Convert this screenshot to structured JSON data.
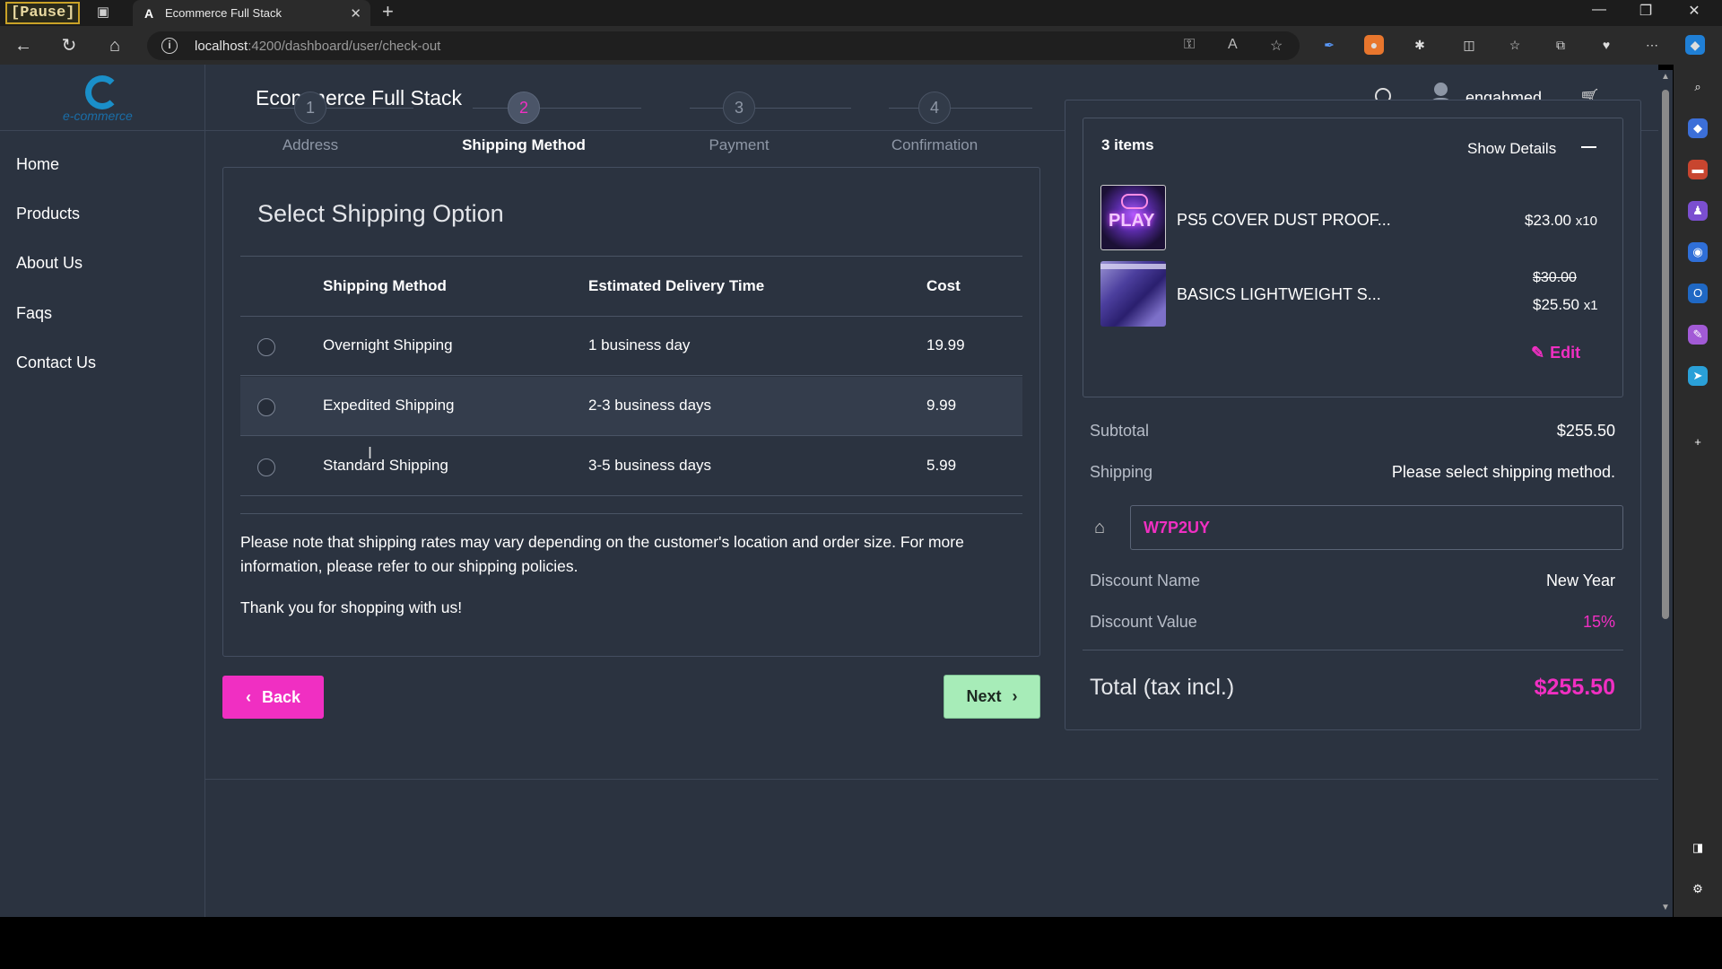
{
  "browser": {
    "pause_label": "[Pause]",
    "tab_title": "Ecommerce Full Stack",
    "url_host": "localhost",
    "url_path": ":4200/dashboard/user/check-out"
  },
  "app": {
    "logo_text": "e-commerce",
    "title": "Ecommerce Full Stack",
    "username": "engahmed"
  },
  "sidebar": {
    "items": [
      {
        "label": "Home"
      },
      {
        "label": "Products"
      },
      {
        "label": "About Us"
      },
      {
        "label": "Faqs"
      },
      {
        "label": "Contact Us"
      }
    ]
  },
  "stepper": {
    "steps": [
      {
        "num": "1",
        "label": "Address",
        "active": false
      },
      {
        "num": "2",
        "label": "Shipping Method",
        "active": true
      },
      {
        "num": "3",
        "label": "Payment",
        "active": false
      },
      {
        "num": "4",
        "label": "Confirmation",
        "active": false
      }
    ]
  },
  "shipping": {
    "title": "Select Shipping Option",
    "headers": {
      "method": "Shipping Method",
      "time": "Estimated Delivery Time",
      "cost": "Cost"
    },
    "options": [
      {
        "method": "Overnight Shipping",
        "time": "1 business day",
        "cost": "19.99"
      },
      {
        "method": "Expedited Shipping",
        "time": "2-3 business days",
        "cost": "9.99"
      },
      {
        "method": "Standard Shipping",
        "time": "3-5 business days",
        "cost": "5.99"
      }
    ],
    "note": "Please note that shipping rates may vary depending on the customer's location and order size. For more information, please refer to our shipping policies.",
    "thanks": "Thank you for shopping with us!"
  },
  "buttons": {
    "back": "Back",
    "next": "Next"
  },
  "summary": {
    "items_count": "3 items",
    "show_details": "Show Details",
    "items": [
      {
        "name": "PS5 COVER DUST PROOF...",
        "price": "$23.00",
        "qty": "x10",
        "old_price": ""
      },
      {
        "name": "BASICS LIGHTWEIGHT S...",
        "price": "$25.50",
        "qty": "x1",
        "old_price": "$30.00"
      }
    ],
    "edit": "Edit",
    "subtotal_label": "Subtotal",
    "subtotal_value": "$255.50",
    "shipping_label": "Shipping",
    "shipping_value": "Please select shipping method.",
    "coupon_code": "W7P2UY",
    "discount_name_label": "Discount Name",
    "discount_name_value": "New Year",
    "discount_value_label": "Discount Value",
    "discount_value": "15%",
    "total_label": "Total (tax incl.)",
    "total_value": "$255.50"
  },
  "colors": {
    "accent": "#f02fc2",
    "next_button": "#a7ecb8",
    "background": "#2b3340"
  }
}
